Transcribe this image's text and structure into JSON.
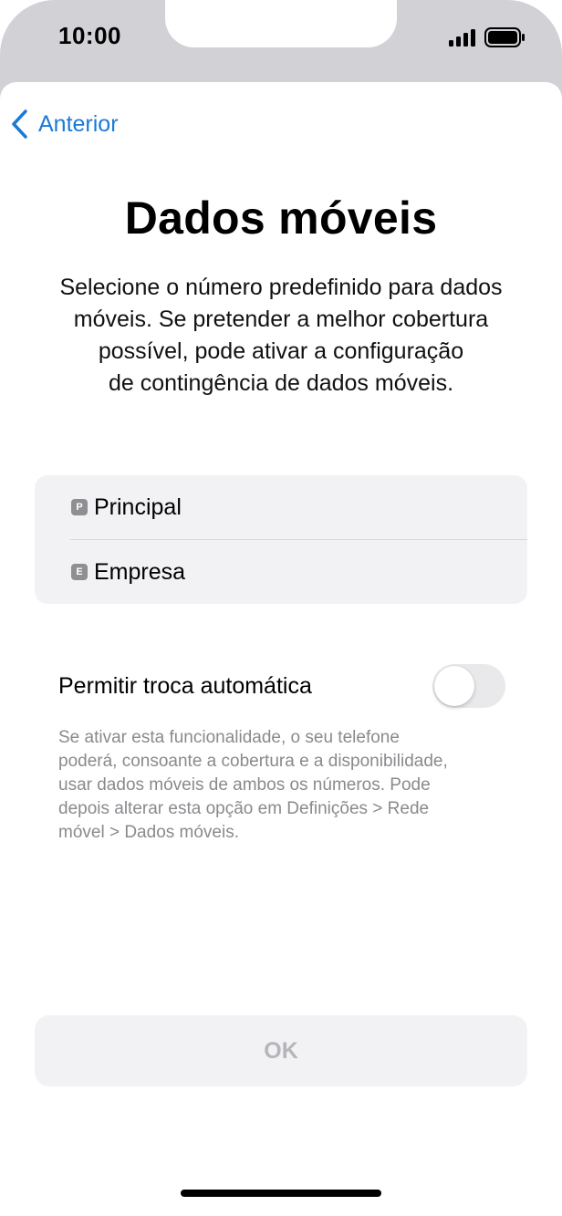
{
  "status_bar": {
    "time": "10:00",
    "signal_icon": "cellular-signal-icon",
    "battery_icon": "battery-icon"
  },
  "nav": {
    "back_label": "Anterior",
    "back_icon": "chevron-left-icon"
  },
  "page": {
    "title": "Dados móveis",
    "subtitle": "Selecione o número predefinido para dados\nmóveis. Se pretender a melhor cobertura\npossível, pode ativar a configuração\nde contingência de dados móveis."
  },
  "lines": [
    {
      "badge": "P",
      "label": "Principal"
    },
    {
      "badge": "E",
      "label": "Empresa"
    }
  ],
  "auto_switch": {
    "label": "Permitir troca automática",
    "enabled": false,
    "help": "Se ativar esta funcionalidade, o seu telefone\npoderá, consoante a cobertura e a disponibilidade,\nusar dados móveis de ambos os números. Pode\ndepois alterar esta opção em Definições > Rede\nmóvel > Dados móveis."
  },
  "footer": {
    "ok_label": "OK"
  },
  "colors": {
    "accent": "#1b7ad6",
    "card_bg": "#f2f2f4",
    "secondary_text": "#8a8a8e",
    "disabled_text": "#b5b5ba"
  }
}
